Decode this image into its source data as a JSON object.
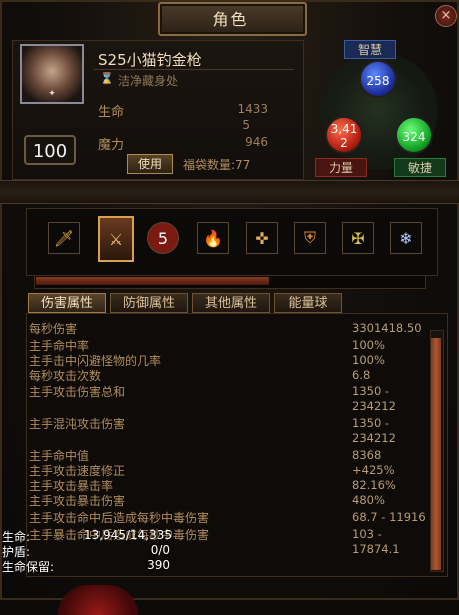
{
  "window": {
    "title": "角色",
    "close_glyph": "×"
  },
  "character": {
    "name": "S25小猫钓金枪",
    "location": "洁净藏身处",
    "level": "100",
    "avatar_tag": "✦"
  },
  "vitals": [
    {
      "label": "生命",
      "value": "1433"
    },
    {
      "label": "",
      "value": "5"
    },
    {
      "label": "魔力",
      "value": "946"
    }
  ],
  "actions": {
    "use_label": "使用",
    "bag_count": "福袋数量:77"
  },
  "attributes": {
    "intelligence": {
      "label": "智慧",
      "value": "258",
      "color": "#3a5aff"
    },
    "strength": {
      "label": "力量",
      "value": "3,41\n2",
      "color": "#d62a14"
    },
    "dexterity": {
      "label": "敏捷",
      "value": "324",
      "color": "#22c030"
    }
  },
  "skills": [
    {
      "icon": "sword-icon",
      "glyph": "🗡"
    },
    {
      "icon": "weapon-card-icon",
      "glyph": "⚔",
      "selected": true
    },
    {
      "icon": "charge-5-icon",
      "glyph": "5"
    },
    {
      "icon": "fire-skill-icon",
      "glyph": "🔥"
    },
    {
      "icon": "compass-skill-icon",
      "glyph": "✜"
    },
    {
      "icon": "shield-skill-icon",
      "glyph": "⛨"
    },
    {
      "icon": "crossed-skill-icon",
      "glyph": "✠"
    },
    {
      "icon": "frost-skill-icon",
      "glyph": "❄"
    }
  ],
  "experience_progress": 0.6,
  "tabs": [
    {
      "label": "伤害属性",
      "active": true
    },
    {
      "label": "防御属性",
      "active": false
    },
    {
      "label": "其他属性",
      "active": false
    },
    {
      "label": "能量球",
      "active": false
    }
  ],
  "damage_stats": [
    {
      "label": "每秒伤害",
      "value": "3301418.50"
    },
    {
      "label": "主手命中率",
      "value": "100%"
    },
    {
      "label": "主手击中闪避怪物的几率",
      "value": "100%"
    },
    {
      "label": "每秒攻击次数",
      "value": "6.8"
    },
    {
      "label": "主手攻击伤害总和",
      "value": "1350 -\n234212"
    },
    {
      "label": "主手混沌攻击伤害",
      "value": "1350 -\n234212"
    },
    {
      "label": "主手命中值",
      "value": "8368"
    },
    {
      "label": "主手攻击速度修正",
      "value": "+425%"
    },
    {
      "label": "主手攻击暴击率",
      "value": "82.16%"
    },
    {
      "label": "主手攻击暴击伤害",
      "value": "480%"
    },
    {
      "label": "主手攻击命中后造成每秒中毒伤害",
      "value": "68.7 - 11916"
    },
    {
      "label": "主手暴击命中后造成每秒中毒伤害",
      "value": "103 -\n17874.1"
    }
  ],
  "overlay": [
    {
      "label": "生命:",
      "value": "13,945/14,335"
    },
    {
      "label": "护盾:",
      "value": "0/0"
    },
    {
      "label": "生命保留:",
      "value": "390"
    }
  ]
}
